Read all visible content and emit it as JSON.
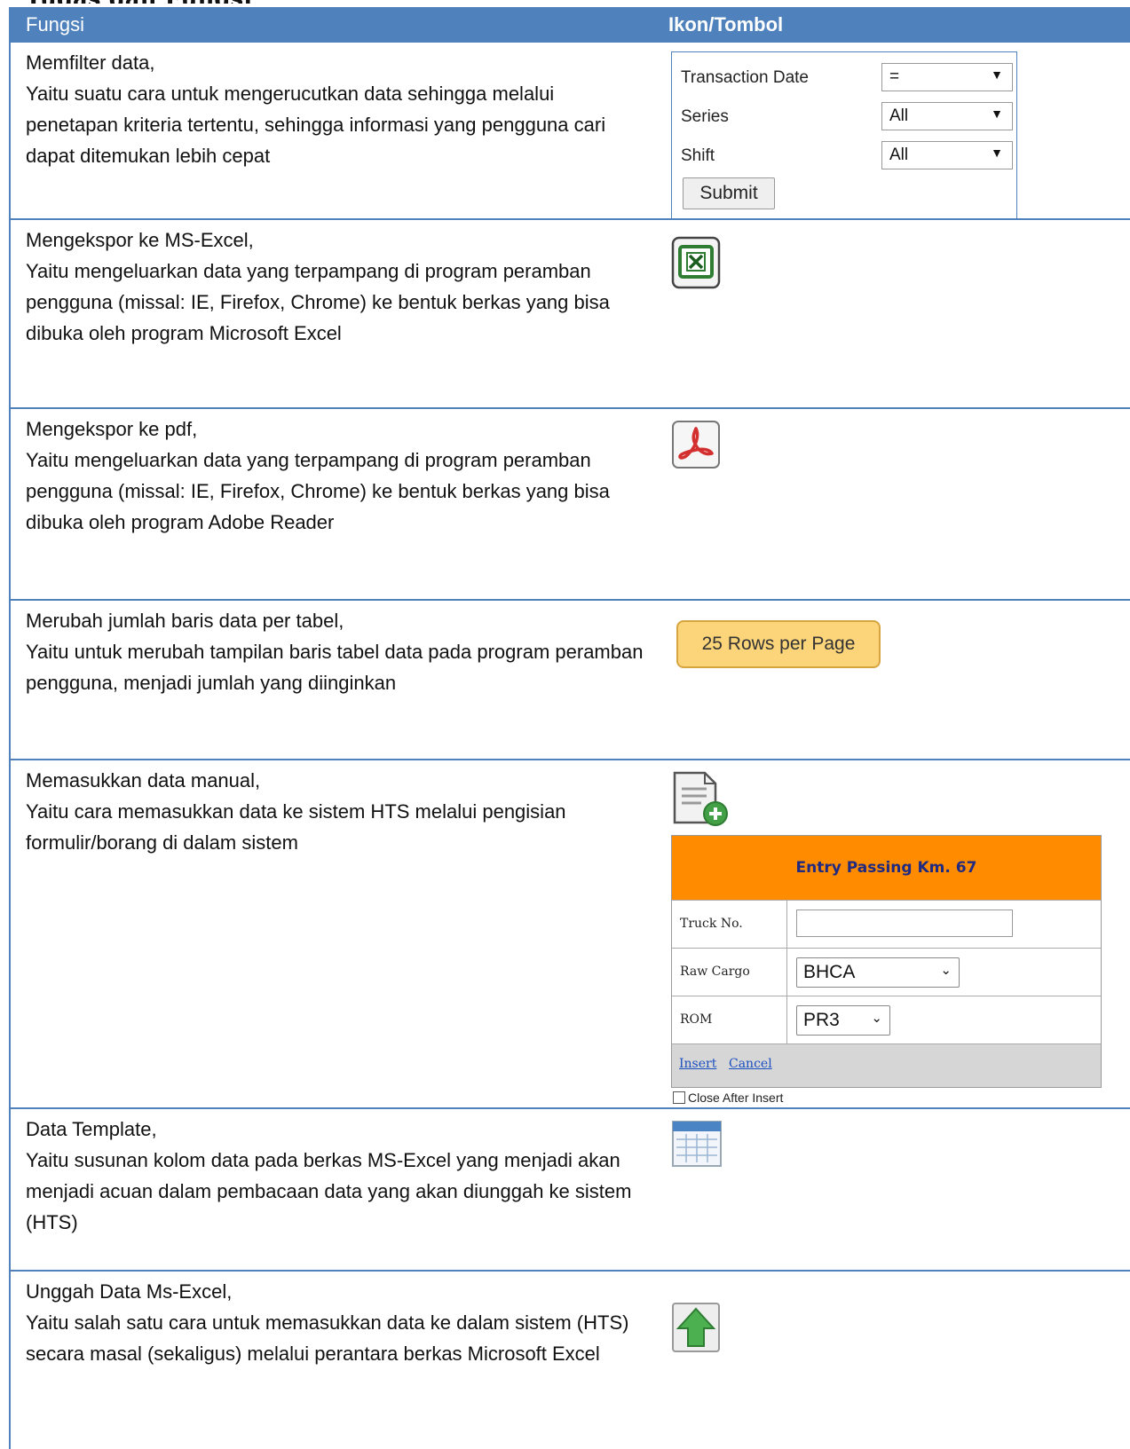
{
  "header": {
    "col1": "Fungsi",
    "col2": "Ikon/Tombol"
  },
  "rows": [
    {
      "desc": "Memfilter data,\nYaitu suatu cara untuk mengerucutkan data sehingga melalui penetapan kriteria tertentu, sehingga informasi yang pengguna cari dapat ditemukan lebih cepat"
    },
    {
      "desc": "Mengekspor ke MS-Excel,\nYaitu mengeluarkan data yang terpampang di program peramban pengguna (missal: IE, Firefox, Chrome) ke bentuk berkas yang bisa dibuka oleh program Microsoft Excel"
    },
    {
      "desc": "Mengekspor ke pdf,\nYaitu mengeluarkan data yang terpampang di program peramban pengguna (missal: IE, Firefox, Chrome) ke bentuk berkas yang bisa dibuka oleh program Adobe Reader"
    },
    {
      "desc": "Merubah jumlah baris data per tabel,\nYaitu untuk merubah tampilan baris tabel data pada program peramban pengguna, menjadi jumlah yang diinginkan"
    },
    {
      "desc": "Memasukkan data manual,\nYaitu cara memasukkan data ke sistem HTS melalui pengisian formulir/borang di dalam sistem"
    },
    {
      "desc": "Data Template,\nYaitu susunan kolom data pada berkas MS-Excel yang menjadi akan menjadi acuan dalam pembacaan data yang akan diunggah ke sistem (HTS)"
    },
    {
      "desc": "Unggah Data Ms-Excel,\nYaitu salah satu cara untuk memasukkan data ke dalam sistem (HTS) secara masal (sekaligus) melalui perantara berkas Microsoft Excel"
    }
  ],
  "filter": {
    "transaction_date_label": "Transaction Date",
    "transaction_date_value": "=",
    "series_label": "Series",
    "series_value": "All",
    "shift_label": "Shift",
    "shift_value": "All",
    "submit_label": "Submit",
    "arrow": "▼"
  },
  "rows_per_page": {
    "label": "25 Rows per Page"
  },
  "entry_form": {
    "title": "Entry Passing Km. 67",
    "truck_label": "Truck No.",
    "truck_value": "",
    "raw_cargo_label": "Raw Cargo",
    "raw_cargo_value": "BHCA",
    "rom_label": "ROM",
    "rom_value": "PR3",
    "select_arrow": "⌄",
    "insert_label": "Insert",
    "cancel_label": "Cancel",
    "close_after_label": "Close After Insert"
  },
  "colors": {
    "header_blue": "#4f81bd",
    "excel_green": "#1e8e3e",
    "pdf_red": "#d32f2f",
    "upload_green": "#43a047",
    "rows_button": "#fcd47a",
    "form_header": "#ff8c00"
  },
  "icons": [
    "excel-export-icon",
    "pdf-export-icon",
    "add-document-icon",
    "data-template-icon",
    "upload-icon"
  ]
}
